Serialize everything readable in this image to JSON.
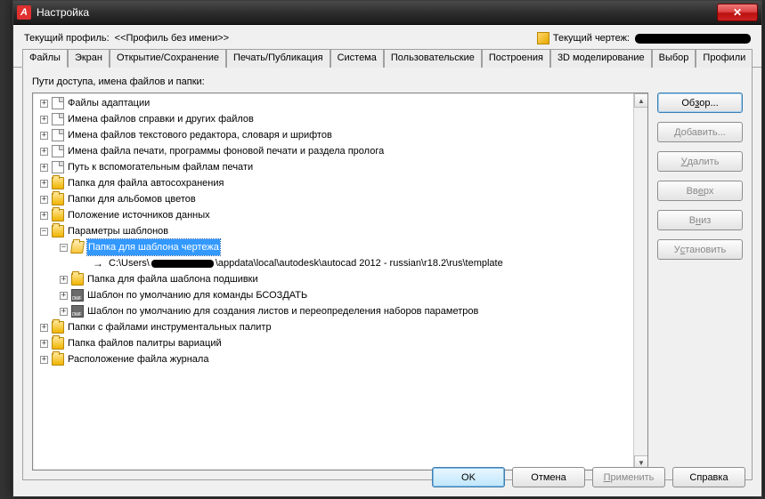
{
  "window": {
    "title": "Настройка"
  },
  "profile": {
    "label": "Текущий профиль:",
    "value": "<<Профиль без имени>>",
    "drawing_label": "Текущий чертеж:"
  },
  "tabs": [
    "Файлы",
    "Экран",
    "Открытие/Сохранение",
    "Печать/Публикация",
    "Система",
    "Пользовательские",
    "Построения",
    "3D моделирование",
    "Выбор",
    "Профили"
  ],
  "active_tab": 0,
  "panel_label": "Пути доступа, имена файлов и папки:",
  "tree": [
    {
      "level": 0,
      "icon": "file",
      "exp": "+",
      "text": "Файлы адаптации"
    },
    {
      "level": 0,
      "icon": "file",
      "exp": "+",
      "text": "Имена файлов справки и других файлов"
    },
    {
      "level": 0,
      "icon": "file",
      "exp": "+",
      "text": "Имена файлов текстового редактора, словаря и шрифтов"
    },
    {
      "level": 0,
      "icon": "file",
      "exp": "+",
      "text": "Имена файла печати, программы фоновой печати и раздела пролога"
    },
    {
      "level": 0,
      "icon": "file",
      "exp": "+",
      "text": "Путь к вспомогательным файлам печати"
    },
    {
      "level": 0,
      "icon": "folder",
      "exp": "+",
      "text": "Папка для файла автосохранения"
    },
    {
      "level": 0,
      "icon": "folder",
      "exp": "+",
      "text": "Папки для альбомов цветов"
    },
    {
      "level": 0,
      "icon": "folder",
      "exp": "+",
      "text": "Положение источников данных"
    },
    {
      "level": 0,
      "icon": "folder",
      "exp": "-",
      "text": "Параметры шаблонов"
    },
    {
      "level": 1,
      "icon": "folder-open",
      "exp": "-",
      "text": "Папка для шаблона чертежа",
      "selected": true
    },
    {
      "level": 2,
      "icon": "arrow-path",
      "exp": "",
      "path_prefix": "C:\\Users\\",
      "path_suffix": "\\appdata\\local\\autodesk\\autocad 2012 - russian\\r18.2\\rus\\template"
    },
    {
      "level": 1,
      "icon": "folder",
      "exp": "+",
      "text": "Папка для файла шаблона подшивки"
    },
    {
      "level": 1,
      "icon": "dwg",
      "exp": "+",
      "text": "Шаблон по умолчанию для команды БСОЗДАТЬ"
    },
    {
      "level": 1,
      "icon": "dwg",
      "exp": "+",
      "text": "Шаблон по умолчанию для создания листов и переопределения наборов параметров"
    },
    {
      "level": 0,
      "icon": "folder",
      "exp": "+",
      "text": "Папки с файлами инструментальных палитр"
    },
    {
      "level": 0,
      "icon": "folder",
      "exp": "+",
      "text": "Папка файлов палитры вариаций"
    },
    {
      "level": 0,
      "icon": "folder",
      "exp": "+",
      "text": "Расположение файла журнала"
    }
  ],
  "side_buttons": {
    "browse": {
      "pre": "Об",
      "m": "з",
      "post": "ор..."
    },
    "add": {
      "pre": "",
      "m": "Д",
      "post": "обавить..."
    },
    "remove": {
      "pre": "",
      "m": "У",
      "post": "далить"
    },
    "up": {
      "pre": "Вв",
      "m": "е",
      "post": "рх"
    },
    "down": {
      "pre": "В",
      "m": "н",
      "post": "из"
    },
    "set": {
      "pre": "У",
      "m": "с",
      "post": "тановить"
    }
  },
  "footer": {
    "ok": "OK",
    "cancel": "Отмена",
    "apply": {
      "pre": "",
      "m": "П",
      "post": "рименить"
    },
    "help": "Справка"
  }
}
